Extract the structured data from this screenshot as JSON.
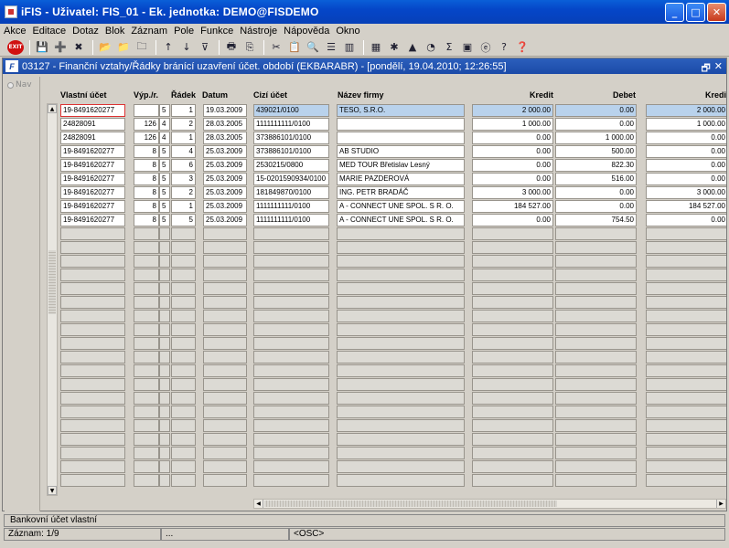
{
  "window": {
    "title": "iFIS - Uživatel: FIS_01 - Ek. jednotka: DEMO@FISDEMO",
    "minimize": "_",
    "maximize": "□",
    "close": "✕"
  },
  "menu": [
    "Akce",
    "Editace",
    "Dotaz",
    "Blok",
    "Záznam",
    "Pole",
    "Funkce",
    "Nástroje",
    "Nápověda",
    "Okno"
  ],
  "toolbar": {
    "exit_label": "EXIT",
    "icons": [
      "save-icon",
      "insert-record-icon",
      "delete-record-icon",
      "query-enter-icon",
      "query-execute-icon",
      "query-cancel-icon",
      "sort-asc-icon",
      "sort-desc-icon",
      "filter-icon",
      "print-icon",
      "cut-icon",
      "copy-icon",
      "paste-icon",
      "list-icon",
      "columns-icon",
      "calculator-icon",
      "settings-icon",
      "chart-icon",
      "clock-icon",
      "sum-icon",
      "excel-icon",
      "ie-icon",
      "help-icon",
      "context-help-icon"
    ]
  },
  "form": {
    "title": "03127 - Finanční vztahy/Řádky bránící uzavření účet. období (EKBARABR) - [pondělí, 19.04.2010; 12:26:55]",
    "icon_label": "F",
    "restore": "🗗",
    "close": "✕",
    "nav_label": "Nav"
  },
  "table": {
    "columns": [
      "Vlastní účet",
      "Výp./r.",
      "Řádek",
      "Datum",
      "Cizí účet",
      "Název firmy",
      "Kredit",
      "Debet",
      "Kredi"
    ],
    "rows": [
      {
        "account": "19-8491620277",
        "vyp": "",
        "r": "5",
        "radek": "1",
        "datum": "19.03.2009",
        "cizi": "439021/0100",
        "firma": "TESO, S.R.O.",
        "kredit": "2 000.00",
        "debet": "0.00",
        "kredit2": "2 000.00"
      },
      {
        "account": "24828091",
        "vyp": "126",
        "r": "4",
        "radek": "2",
        "datum": "28.03.2005",
        "cizi": "1111111111/0100",
        "firma": "",
        "kredit": "1 000.00",
        "debet": "0.00",
        "kredit2": "1 000.00"
      },
      {
        "account": "24828091",
        "vyp": "126",
        "r": "4",
        "radek": "1",
        "datum": "28.03.2005",
        "cizi": "373886101/0100",
        "firma": "",
        "kredit": "0.00",
        "debet": "1 000.00",
        "kredit2": "0.00"
      },
      {
        "account": "19-8491620277",
        "vyp": "8",
        "r": "5",
        "radek": "4",
        "datum": "25.03.2009",
        "cizi": "373886101/0100",
        "firma": "AB STUDIO",
        "kredit": "0.00",
        "debet": "500.00",
        "kredit2": "0.00"
      },
      {
        "account": "19-8491620277",
        "vyp": "8",
        "r": "5",
        "radek": "6",
        "datum": "25.03.2009",
        "cizi": "2530215/0800",
        "firma": "MED TOUR Břetislav Lesný",
        "kredit": "0.00",
        "debet": "822.30",
        "kredit2": "0.00"
      },
      {
        "account": "19-8491620277",
        "vyp": "8",
        "r": "5",
        "radek": "3",
        "datum": "25.03.2009",
        "cizi": "15-0201590934/0100",
        "firma": "MARIE PAZDEROVÁ",
        "kredit": "0.00",
        "debet": "516.00",
        "kredit2": "0.00"
      },
      {
        "account": "19-8491620277",
        "vyp": "8",
        "r": "5",
        "radek": "2",
        "datum": "25.03.2009",
        "cizi": "181849870/0100",
        "firma": "ING. PETR BRADÁČ",
        "kredit": "3 000.00",
        "debet": "0.00",
        "kredit2": "3 000.00"
      },
      {
        "account": "19-8491620277",
        "vyp": "8",
        "r": "5",
        "radek": "1",
        "datum": "25.03.2009",
        "cizi": "1111111111/0100",
        "firma": "A - CONNECT UNE SPOL. S R. O.",
        "kredit": "184 527.00",
        "debet": "0.00",
        "kredit2": "184 527.00"
      },
      {
        "account": "19-8491620277",
        "vyp": "8",
        "r": "5",
        "radek": "5",
        "datum": "25.03.2009",
        "cizi": "1111111111/0100",
        "firma": "A - CONNECT UNE SPOL. S R. O.",
        "kredit": "0.00",
        "debet": "754.50",
        "kredit2": "0.00"
      }
    ],
    "empty_rows": 19
  },
  "status": {
    "hint": "Bankovní účet vlastní",
    "record": "Záznam: 1/9",
    "seg2": "...",
    "osc": "<OSC>"
  }
}
